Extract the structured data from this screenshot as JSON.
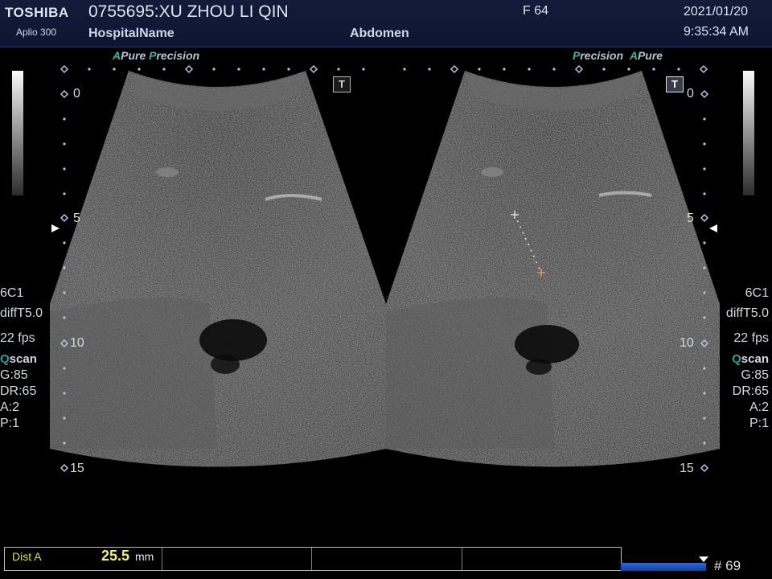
{
  "header": {
    "brand": "TOSHIBA",
    "model": "Aplio 300",
    "patient": "0755695:XU ZHOU LI QIN",
    "hospital": "HospitalName",
    "preset": "Abdomen",
    "frequency": "F  64",
    "date": "2021/01/20",
    "time": "9:35:34 AM"
  },
  "left_panel": {
    "tag_first": "A",
    "tag_first_text": "Pure ",
    "tag_second": "P",
    "tag_second_text": "recision",
    "marker": "T",
    "depth_labels": [
      "0",
      "5",
      "10",
      "15"
    ]
  },
  "right_panel": {
    "tag_first": "P",
    "tag_first_text": "recision",
    "tag_second": "A",
    "tag_second_text": "Pure",
    "marker": "T",
    "depth_labels": [
      "0",
      "5",
      "10",
      "15"
    ]
  },
  "params_left": {
    "probe": "6C1",
    "mode": "diffT5.0",
    "fps": "22 fps",
    "qscan_q": "Q",
    "qscan_rest": "scan",
    "gain": "G:85",
    "dr": "DR:65",
    "a": "A:2",
    "p": "P:1"
  },
  "params_right": {
    "probe": "6C1",
    "mode": "diffT5.0",
    "fps": "22 fps",
    "qscan_q": "Q",
    "qscan_rest": "scan",
    "gain": "G:85",
    "dr": "DR:65",
    "a": "A:2",
    "p": "P:1"
  },
  "measurement": {
    "label": "Dist A",
    "value": "25.5",
    "unit": "mm"
  },
  "cine": {
    "frame": "# 69"
  },
  "colors": {
    "header_bg": "#0d1530",
    "accent_green": "#3fb39a",
    "measure_yellow": "#f3f07a",
    "cine_blue": "#2a6bdc"
  }
}
